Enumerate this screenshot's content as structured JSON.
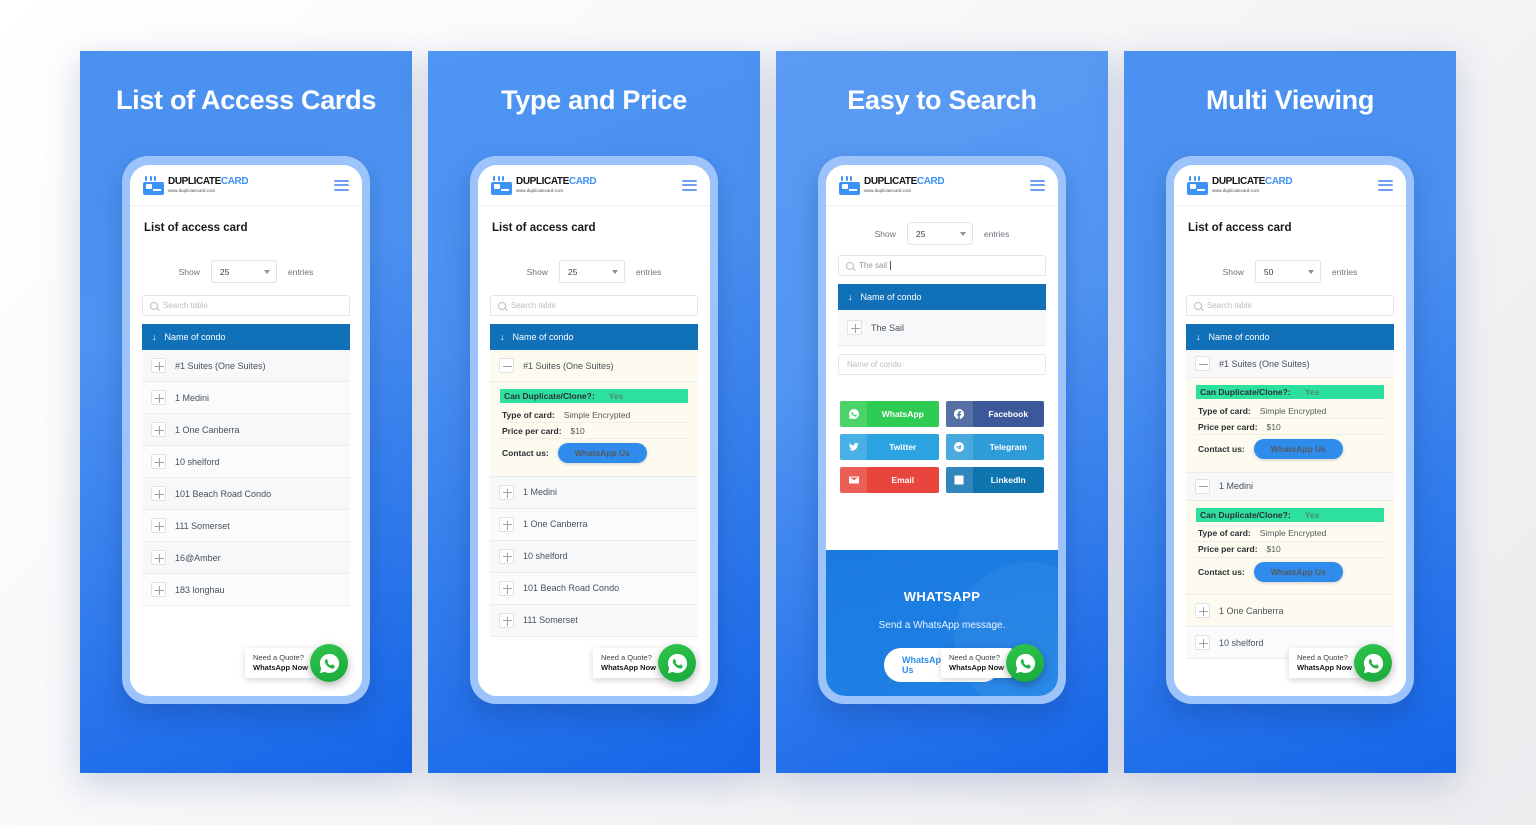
{
  "panels": [
    {
      "title": "List of Access Cards",
      "heading": "List of access card",
      "show_label": "Show",
      "entries_label": "entries",
      "entries_value": "25",
      "search_placeholder": "Search table",
      "column_header": "Name of condo",
      "sort_icon": "↓",
      "rows": [
        "#1 Suites (One Suites)",
        "1 Medini",
        "1 One Canberra",
        "10 shelford",
        "101 Beach Road Condo",
        "111 Somerset",
        "16@Amber",
        "183 longhau"
      ]
    },
    {
      "title": "Type and Price",
      "heading": "List of access card",
      "show_label": "Show",
      "entries_label": "entries",
      "entries_value": "25",
      "search_placeholder": "Search table",
      "column_header": "Name of condo",
      "sort_icon": "↓",
      "expanded_row": "#1 Suites (One Suites)",
      "detail": {
        "duplicate_label": "Can Duplicate/Clone?:",
        "duplicate_value": "Yes",
        "type_label": "Type of card:",
        "type_value": "Simple Encrypted",
        "price_label": "Price per card:",
        "price_value": "$10",
        "contact_label": "Contact us:",
        "contact_button": "WhatsApp Us"
      },
      "rows": [
        "1 Medini",
        "1 One Canberra",
        "10 shelford",
        "101 Beach Road Condo",
        "111 Somerset"
      ]
    },
    {
      "title": "Easy to Search",
      "show_label": "Show",
      "entries_label": "entries",
      "entries_value": "25",
      "search_value": "The sail",
      "column_header": "Name of condo",
      "sort_icon": "↓",
      "rows": [
        "The Sail"
      ],
      "name_input_placeholder": "Name of condo",
      "social": [
        {
          "label": "WhatsApp",
          "icon": "whatsapp-icon",
          "glyph": "✆",
          "color": "#2ecc52"
        },
        {
          "label": "Facebook",
          "icon": "facebook-icon",
          "glyph": "f",
          "color": "#3b5998"
        },
        {
          "label": "Twitter",
          "icon": "twitter-icon",
          "glyph": "ᴠ",
          "color": "#2aa3e0"
        },
        {
          "label": "Telegram",
          "icon": "telegram-icon",
          "glyph": "➤",
          "color": "#2d9cd8"
        },
        {
          "label": "Email",
          "icon": "email-icon",
          "glyph": "✉",
          "color": "#e8453c"
        },
        {
          "label": "LinkedIn",
          "icon": "linkedin-icon",
          "glyph": "in",
          "color": "#1074b0"
        }
      ],
      "footer": {
        "title": "WHATSAPP",
        "subtitle": "Send a WhatsApp message.",
        "button": "WhatsApp Us",
        "arrow": "›"
      }
    },
    {
      "title": "Multi Viewing",
      "heading": "List of access card",
      "show_label": "Show",
      "entries_label": "entries",
      "entries_value": "50",
      "search_placeholder": "Search table",
      "column_header": "Name of condo",
      "sort_icon": "↓",
      "expanded_rows": [
        "#1 Suites (One Suites)",
        "1 Medini"
      ],
      "detail": {
        "duplicate_label": "Can Duplicate/Clone?:",
        "duplicate_value": "Yes",
        "type_label": "Type of card:",
        "type_value": "Simple Encrypted",
        "price_label": "Price per card:",
        "price_value": "$10",
        "contact_label": "Contact us:",
        "contact_button": "WhatsApp Us"
      },
      "rows": [
        "1 One Canberra",
        "10 shelford"
      ]
    }
  ],
  "logo": {
    "name_dark": "DUPLICATE",
    "name_blue": "CARD",
    "url": "www.duplicatecard.com"
  },
  "whatsapp_widget": {
    "line1": "Need a Quote?",
    "line2": "WhatsApp Now"
  },
  "colors": {
    "panel_blue": "#1565e8",
    "table_header": "#1071b9",
    "duplicate_green": "#2ee0a0",
    "whatsapp_green": "#18a83a",
    "button_blue": "#2f8ced"
  }
}
